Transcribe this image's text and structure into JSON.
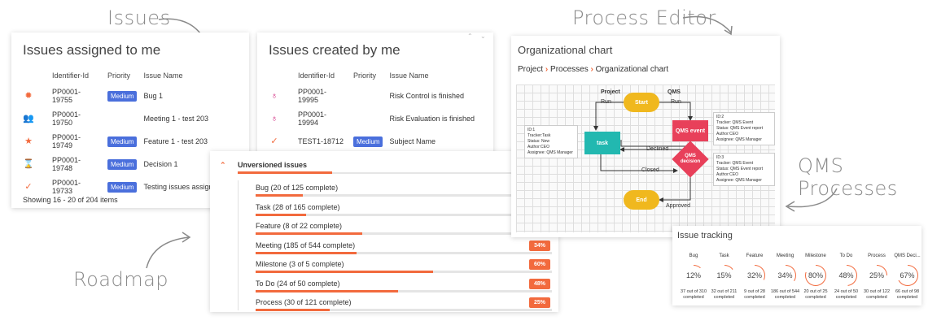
{
  "labels": {
    "issues": "Issues",
    "process_editor": "Process Editor",
    "qms_processes": "QMS Processes",
    "roadmap": "Roadmap"
  },
  "assigned": {
    "title": "Issues assigned to me",
    "headers": [
      "Identifier-Id",
      "Priority",
      "Issue Name"
    ],
    "rows": [
      {
        "icon": "bug-icon",
        "id": "PP0001-19755",
        "priority": "Medium",
        "name": "Bug 1"
      },
      {
        "icon": "people-icon",
        "id": "PP0001-19750",
        "priority": "",
        "name": "Meeting 1 - test 203"
      },
      {
        "icon": "star-icon",
        "id": "PP0001-19749",
        "priority": "Medium",
        "name": "Feature 1 - test 203"
      },
      {
        "icon": "hourglass-icon",
        "id": "PP0001-19748",
        "priority": "Medium",
        "name": "Decision 1"
      },
      {
        "icon": "check-icon",
        "id": "PP0001-19733",
        "priority": "Medium",
        "name": "Testing issues assigned"
      }
    ],
    "footer": "Showing 16 - 20 of 204 items"
  },
  "created": {
    "title": "Issues created by me",
    "headers": [
      "Identifier-Id",
      "Priority",
      "Issue Name"
    ],
    "rows": [
      {
        "icon": "bulb-icon",
        "id": "PP0001-19995",
        "priority": "",
        "name": "Risk Control is finished"
      },
      {
        "icon": "bulb-icon",
        "id": "PP0001-19994",
        "priority": "",
        "name": "Risk Evaluation is finished"
      },
      {
        "icon": "check-icon",
        "id": "TEST1-18712",
        "priority": "Medium",
        "name": "Subject Name"
      }
    ]
  },
  "roadmap": {
    "title": "Unversioned issues",
    "items": [
      {
        "label": "Bug (20 of 125 complete)",
        "fraction": 0.16,
        "pct": ""
      },
      {
        "label": "Task (28 of 165 complete)",
        "fraction": 0.17,
        "pct": ""
      },
      {
        "label": "Feature (8 of 22 complete)",
        "fraction": 0.36,
        "pct": ""
      },
      {
        "label": "Meeting (185 of 544 complete)",
        "fraction": 0.34,
        "pct": "34%"
      },
      {
        "label": "Milestone (3 of 5 complete)",
        "fraction": 0.6,
        "pct": "60%"
      },
      {
        "label": "To Do (24 of 50 complete)",
        "fraction": 0.48,
        "pct": "48%"
      },
      {
        "label": "Process (30 of 121 complete)",
        "fraction": 0.25,
        "pct": "25%"
      }
    ]
  },
  "org": {
    "title": "Organizational chart",
    "crumbs": [
      "Project",
      "Processes",
      "Organizational chart"
    ],
    "lane_project": "Project",
    "lane_qms": "QMS",
    "start": "Start",
    "task": "task",
    "qms_event": "QMS event",
    "qms_decision": "QMS decision",
    "end": "End",
    "run1": "Run",
    "run2": "Run",
    "declined": "Declined",
    "closed": "Closed",
    "approved": "Approved",
    "info1": [
      "ID:1",
      "Tracker:Task",
      "Status: New",
      "Author:CEO",
      "Assignee: QMS Manager"
    ],
    "info2": [
      "ID:2",
      "Tracker: QMS Event",
      "Status: QMS Event report",
      "Author:CEO",
      "Assignee: QMS Manager"
    ],
    "info3": [
      "ID:3",
      "Tracker: QMS Event",
      "Status: QMS Event report",
      "Author:CEO",
      "Assignee: QMS Manager"
    ]
  },
  "tracking": {
    "title": "Issue tracking",
    "items": [
      {
        "name": "Bug",
        "pct": "12%",
        "sub": "37 out of 310 completed"
      },
      {
        "name": "Task",
        "pct": "15%",
        "sub": "32 out of 211 completed"
      },
      {
        "name": "Feature",
        "pct": "32%",
        "sub": "9 out of 28 completed"
      },
      {
        "name": "Meeting",
        "pct": "34%",
        "sub": "186 out of 544 completed"
      },
      {
        "name": "Milestone",
        "pct": "80%",
        "sub": "20 out of 25 completed"
      },
      {
        "name": "To Do",
        "pct": "48%",
        "sub": "24 out of 50 completed"
      },
      {
        "name": "Process",
        "pct": "25%",
        "sub": "30 out of 122 completed"
      },
      {
        "name": "QMS Deci...",
        "pct": "67%",
        "sub": "66 out of 98 completed"
      }
    ]
  },
  "colors": {
    "accent": "#f26a3d",
    "badge": "#4a6fdc",
    "task": "#22b8b0",
    "event": "#e8405a",
    "startend": "#f0b81e"
  }
}
